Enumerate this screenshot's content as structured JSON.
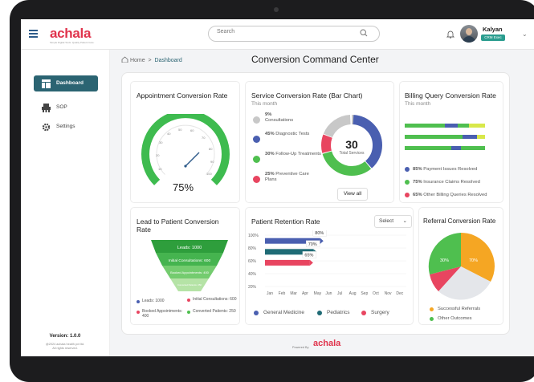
{
  "header": {
    "logo_text": "achala",
    "logo_tagline": "Simple Digital Tools. Quality Patient Care.",
    "search_placeholder": "Search",
    "user_name": "Kalyan",
    "user_role": "CRM Exec"
  },
  "sidebar": {
    "items": [
      {
        "label": "Dashboard",
        "icon": "dashboard-icon",
        "active": true
      },
      {
        "label": "SOP",
        "icon": "sop-icon",
        "active": false
      },
      {
        "label": "Settings",
        "icon": "gear-icon",
        "active": false
      }
    ],
    "version": "Version: 1.0.0",
    "copyright_1": "@2024 achala health pvt ltd.",
    "copyright_2": "All rights reserved."
  },
  "breadcrumb": {
    "home": "Home",
    "current": "Dashboard"
  },
  "page_title": "Conversion Command Center",
  "appointment": {
    "title": "Appointment Conversion Rate",
    "value": "75%",
    "ticks": [
      "0",
      "10",
      "20",
      "30",
      "40",
      "50",
      "60",
      "70",
      "80",
      "90",
      "100"
    ]
  },
  "service": {
    "title": "Service Conversion Rate (Bar Chart)",
    "subtitle": "This month",
    "items": [
      {
        "pct": "9%",
        "label": "Consultations",
        "color": "#c8c8c8"
      },
      {
        "pct": "45%",
        "label": "Diagnostic Tests",
        "color": "#4a5fb0"
      },
      {
        "pct": "30%",
        "label": "Follow-Up Treatments",
        "color": "#4fbf4f"
      },
      {
        "pct": "25%",
        "label": "Preventive Care Plans",
        "color": "#e84560"
      }
    ],
    "total": "30",
    "total_label": "Total Services",
    "view_all": "View all"
  },
  "billing": {
    "title": "Billing Query Conversion Rate",
    "subtitle": "This month",
    "items": [
      {
        "pct": "85%",
        "label": "Payment Issues Resolved",
        "color": "#4a5fb0"
      },
      {
        "pct": "75%",
        "label": "Insurance Claims Resolved",
        "color": "#4fbf4f"
      },
      {
        "pct": "65%",
        "label": "Other Billing Queries Resolved",
        "color": "#e84560"
      }
    ]
  },
  "lead": {
    "title_1": "Lead to Patient Conversion",
    "title_2": "Rate",
    "funnel": [
      "Leads: 1000",
      "Initial Consultations: 600",
      "Booked Appointments: 400",
      "Converted Patients: 250"
    ],
    "legend": [
      {
        "label": "Leads: 1000",
        "color": "#4a5fb0"
      },
      {
        "label": "Initial Consultations: 600",
        "color": "#e84560"
      },
      {
        "label": "Booked Appointments: 400",
        "color": "#e84560"
      },
      {
        "label": "Converted Patients: 250",
        "color": "#4fbf4f"
      }
    ]
  },
  "retention": {
    "title": "Patient Retention Rate",
    "select_label": "Select",
    "yticks": [
      "100%",
      "80%",
      "60%",
      "40%",
      "20%"
    ],
    "months": [
      "Jan",
      "Feb",
      "Mar",
      "Apr",
      "May",
      "Jun",
      "Jul",
      "Aug",
      "Sep",
      "Oct",
      "Nov",
      "Dec"
    ],
    "bars": [
      {
        "name": "General Medicine",
        "value": 80,
        "label": "80%",
        "color": "#4a5fb0"
      },
      {
        "name": "Pediatrics",
        "value": 70,
        "label": "70%",
        "color": "#1f6b75"
      },
      {
        "name": "Surgery",
        "value": 65,
        "label": "65%",
        "color": "#e84560"
      }
    ]
  },
  "referral": {
    "title": "Referral Conversion Rate",
    "labels": [
      "30%",
      "70%"
    ],
    "legend": [
      {
        "label": "Successful Referrals",
        "color": "#f5a623"
      },
      {
        "label": "Other Outcomes",
        "color": "#4fbf4f"
      }
    ]
  },
  "footer": {
    "powered_by": "Powered By",
    "logo_text": "achala"
  }
}
